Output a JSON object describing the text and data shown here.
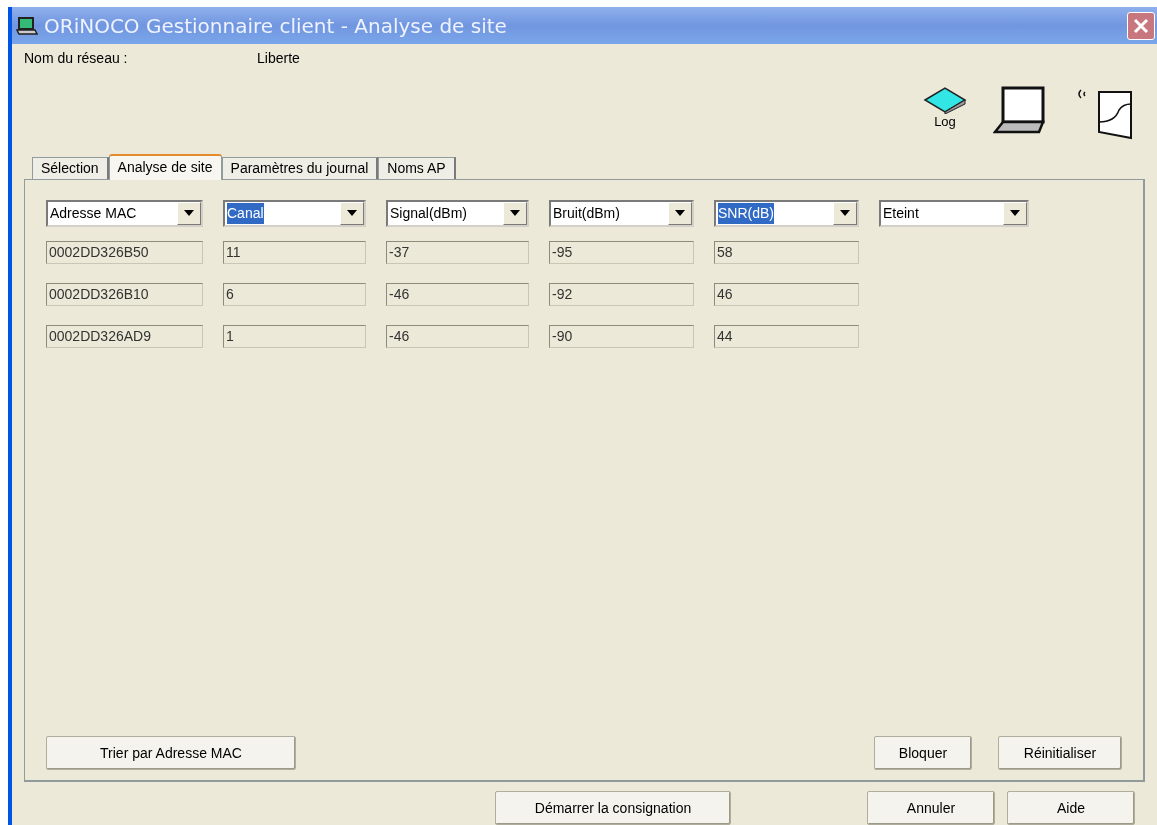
{
  "window": {
    "title": "ORiNOCO Gestionnaire client - Analyse de site"
  },
  "network": {
    "label": "Nom du réseau :",
    "value": "Liberte"
  },
  "toolbar": {
    "log_label": "Log"
  },
  "tabs": [
    {
      "label": "Sélection",
      "selected": false
    },
    {
      "label": "Analyse de site",
      "selected": true
    },
    {
      "label": "Paramètres du journal",
      "selected": false
    },
    {
      "label": "Noms AP",
      "selected": false
    }
  ],
  "columns": [
    {
      "value": "Adresse MAC",
      "highlighted": false
    },
    {
      "value": "Canal",
      "highlighted": true
    },
    {
      "value": "Signal(dBm)",
      "highlighted": false
    },
    {
      "value": "Bruit(dBm)",
      "highlighted": false
    },
    {
      "value": "SNR(dB)",
      "highlighted": true
    },
    {
      "value": "Eteint",
      "highlighted": false
    }
  ],
  "rows": [
    [
      "0002DD326B50",
      "11",
      "-37",
      "-95",
      "58"
    ],
    [
      "0002DD326B10",
      "6",
      "-46",
      "-92",
      "46"
    ],
    [
      "0002DD326AD9",
      "1",
      "-46",
      "-90",
      "44"
    ]
  ],
  "panel_buttons": [
    "Trier par Adresse MAC",
    "Bloquer",
    "Réinitialiser"
  ],
  "footer_buttons": [
    "Démarrer la consignation",
    "Annuler",
    "Aide"
  ]
}
